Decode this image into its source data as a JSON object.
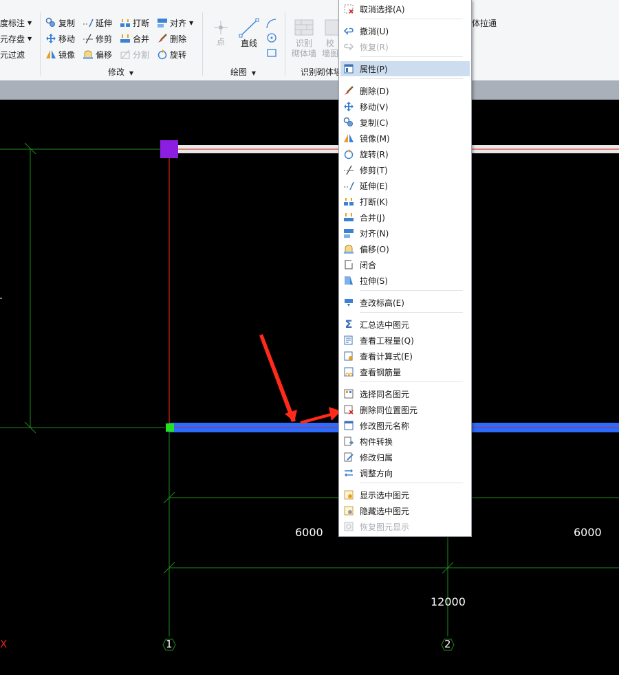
{
  "ribbon": {
    "left_edge": [
      "度标注",
      "元存盘",
      "元过滤"
    ],
    "modify": {
      "items": [
        "复制",
        "延伸",
        "打断",
        "对齐",
        "移动",
        "修剪",
        "合并",
        "删除",
        "镜像",
        "偏移",
        "分割",
        "旋转"
      ],
      "label": "修改"
    },
    "draw": {
      "point": "点",
      "line": "直线",
      "label": "绘图"
    },
    "identify": {
      "btn1_line1": "识别",
      "btn1_line2": "砌体墙",
      "btn2_line1": "校",
      "btn2_line2": "墙图",
      "label": "识别砌体墙"
    },
    "right_btn": "体拉通"
  },
  "context_menu": {
    "items": [
      {
        "label": "取消选择(A)",
        "icon": "deselect-icon"
      },
      {
        "label": "撤消(U)",
        "icon": "undo-icon"
      },
      {
        "label": "恢复(R)",
        "icon": "redo-icon"
      },
      {
        "label": "属性(P)",
        "icon": "properties-icon"
      },
      {
        "label": "删除(D)",
        "icon": "delete-brush-icon"
      },
      {
        "label": "移动(V)",
        "icon": "move-icon"
      },
      {
        "label": "复制(C)",
        "icon": "copy-icon"
      },
      {
        "label": "镜像(M)",
        "icon": "mirror-icon"
      },
      {
        "label": "旋转(R)",
        "icon": "rotate-icon"
      },
      {
        "label": "修剪(T)",
        "icon": "trim-icon"
      },
      {
        "label": "延伸(E)",
        "icon": "extend-icon"
      },
      {
        "label": "打断(K)",
        "icon": "break-icon"
      },
      {
        "label": "合并(J)",
        "icon": "merge-icon"
      },
      {
        "label": "对齐(N)",
        "icon": "align-icon"
      },
      {
        "label": "偏移(O)",
        "icon": "offset-icon"
      },
      {
        "label": "闭合",
        "icon": "close-shape-icon"
      },
      {
        "label": "拉伸(S)",
        "icon": "stretch-icon"
      },
      {
        "label": "查改标高(E)",
        "icon": "elevation-icon"
      },
      {
        "label": "汇总选中图元",
        "icon": "sum-icon"
      },
      {
        "label": "查看工程量(Q)",
        "icon": "quantity-icon"
      },
      {
        "label": "查看计算式(E)",
        "icon": "formula-icon"
      },
      {
        "label": "查看钢筋量",
        "icon": "rebar-icon"
      },
      {
        "label": "选择同名图元",
        "icon": "select-same-icon"
      },
      {
        "label": "删除同位置图元",
        "icon": "delete-same-position-icon"
      },
      {
        "label": "修改图元名称",
        "icon": "rename-icon"
      },
      {
        "label": "构件转换",
        "icon": "convert-icon"
      },
      {
        "label": "修改归属",
        "icon": "ownership-icon"
      },
      {
        "label": "调整方向",
        "icon": "direction-icon"
      },
      {
        "label": "显示选中图元",
        "icon": "show-selected-icon"
      },
      {
        "label": "隐藏选中图元",
        "icon": "hide-selected-icon"
      },
      {
        "label": "恢复图元显示",
        "icon": "restore-display-icon"
      }
    ]
  },
  "canvas": {
    "dim_6000_left": "6000",
    "dim_6000_right": "6000",
    "dim_12000": "12000",
    "axis_1": "1",
    "axis_2": "2",
    "axis_x": "X"
  },
  "colors": {
    "background": "#000000",
    "grid": "#1f8a1f",
    "wall_selected": "#2b6cff",
    "red_axis": "#e0201a",
    "menu_highlight": "#cdddf0",
    "arrow": "#ff2a1a"
  }
}
